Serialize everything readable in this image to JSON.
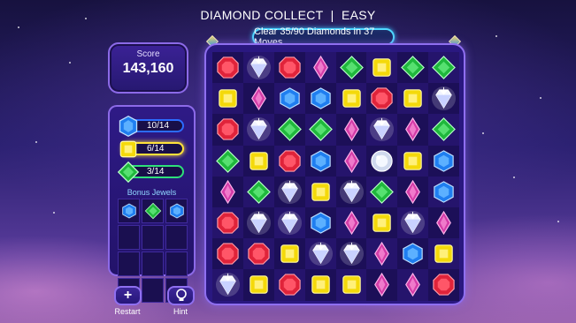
{
  "header": {
    "title": "DIAMOND COLLECT  |  EASY",
    "objective": "Clear 35/90 Diamonds in 37 Moves"
  },
  "score": {
    "label": "Score",
    "value": "143,160"
  },
  "goals": [
    {
      "gem": "blue",
      "text": "10/14"
    },
    {
      "gem": "yellow",
      "text": "6/14"
    },
    {
      "gem": "green",
      "text": "3/14"
    }
  ],
  "bonus": {
    "label": "Bonus Jewels",
    "slots": [
      "blue",
      "green",
      "blue",
      "",
      "",
      "",
      "",
      "",
      "",
      "",
      "",
      ""
    ]
  },
  "buttons": {
    "restart_label": "Restart",
    "restart_icon": "+",
    "hint_label": "Hint"
  },
  "board": [
    [
      "red",
      "diamond",
      "red",
      "purple",
      "green",
      "yellow",
      "green",
      "green"
    ],
    [
      "yellow",
      "purple",
      "blue",
      "blue",
      "yellow",
      "red",
      "yellow",
      "diamond"
    ],
    [
      "red",
      "diamond",
      "green",
      "green",
      "purple",
      "diamond",
      "purple",
      "green"
    ],
    [
      "green",
      "yellow",
      "red",
      "blue",
      "purple",
      "white",
      "yellow",
      "blue"
    ],
    [
      "purple",
      "green",
      "diamond",
      "yellow",
      "diamond",
      "green",
      "purple",
      "blue"
    ],
    [
      "red",
      "diamond",
      "diamond",
      "blue",
      "purple",
      "yellow",
      "diamond",
      "purple"
    ],
    [
      "red",
      "red",
      "yellow",
      "diamond",
      "diamond",
      "purple",
      "blue",
      "yellow"
    ],
    [
      "diamond",
      "yellow",
      "red",
      "yellow",
      "yellow",
      "purple",
      "purple",
      "red"
    ]
  ],
  "colors": {
    "red": "#e0233a",
    "yellow": "#f4d90a",
    "blue": "#1f7ef0",
    "green": "#1fb83c",
    "purple": "#d43ca8",
    "white": "#e8f0ff",
    "diamond": "#ffffff",
    "objective_border": "#4fd8ff",
    "panel_border": "#8c6ae8"
  }
}
